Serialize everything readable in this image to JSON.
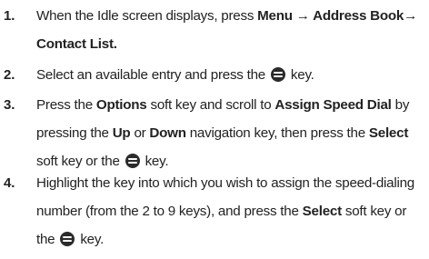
{
  "steps": [
    {
      "number": "1.",
      "parts": [
        "When the Idle screen displays, press ",
        "Menu",
        " → ",
        "Address Book→ Contact List."
      ]
    },
    {
      "number": "2.",
      "parts": [
        "Select an available entry and press the ",
        " key."
      ],
      "icon": "ok-key-icon"
    },
    {
      "number": "3.",
      "parts": [
        "Press the ",
        "Options",
        " soft key and scroll to ",
        "Assign Speed Dial",
        " by pressing the ",
        "Up",
        " or ",
        "Down",
        " navigation key, then press the ",
        "Select",
        " soft key or the ",
        " key."
      ],
      "icon": "ok-key-icon"
    },
    {
      "number": "4.",
      "parts": [
        "Highlight the key into which you wish to assign the speed-dialing number (from the 2 to 9 keys), and press the ",
        "Select",
        " soft key or the ",
        " key."
      ],
      "icon": "ok-key-icon"
    }
  ]
}
